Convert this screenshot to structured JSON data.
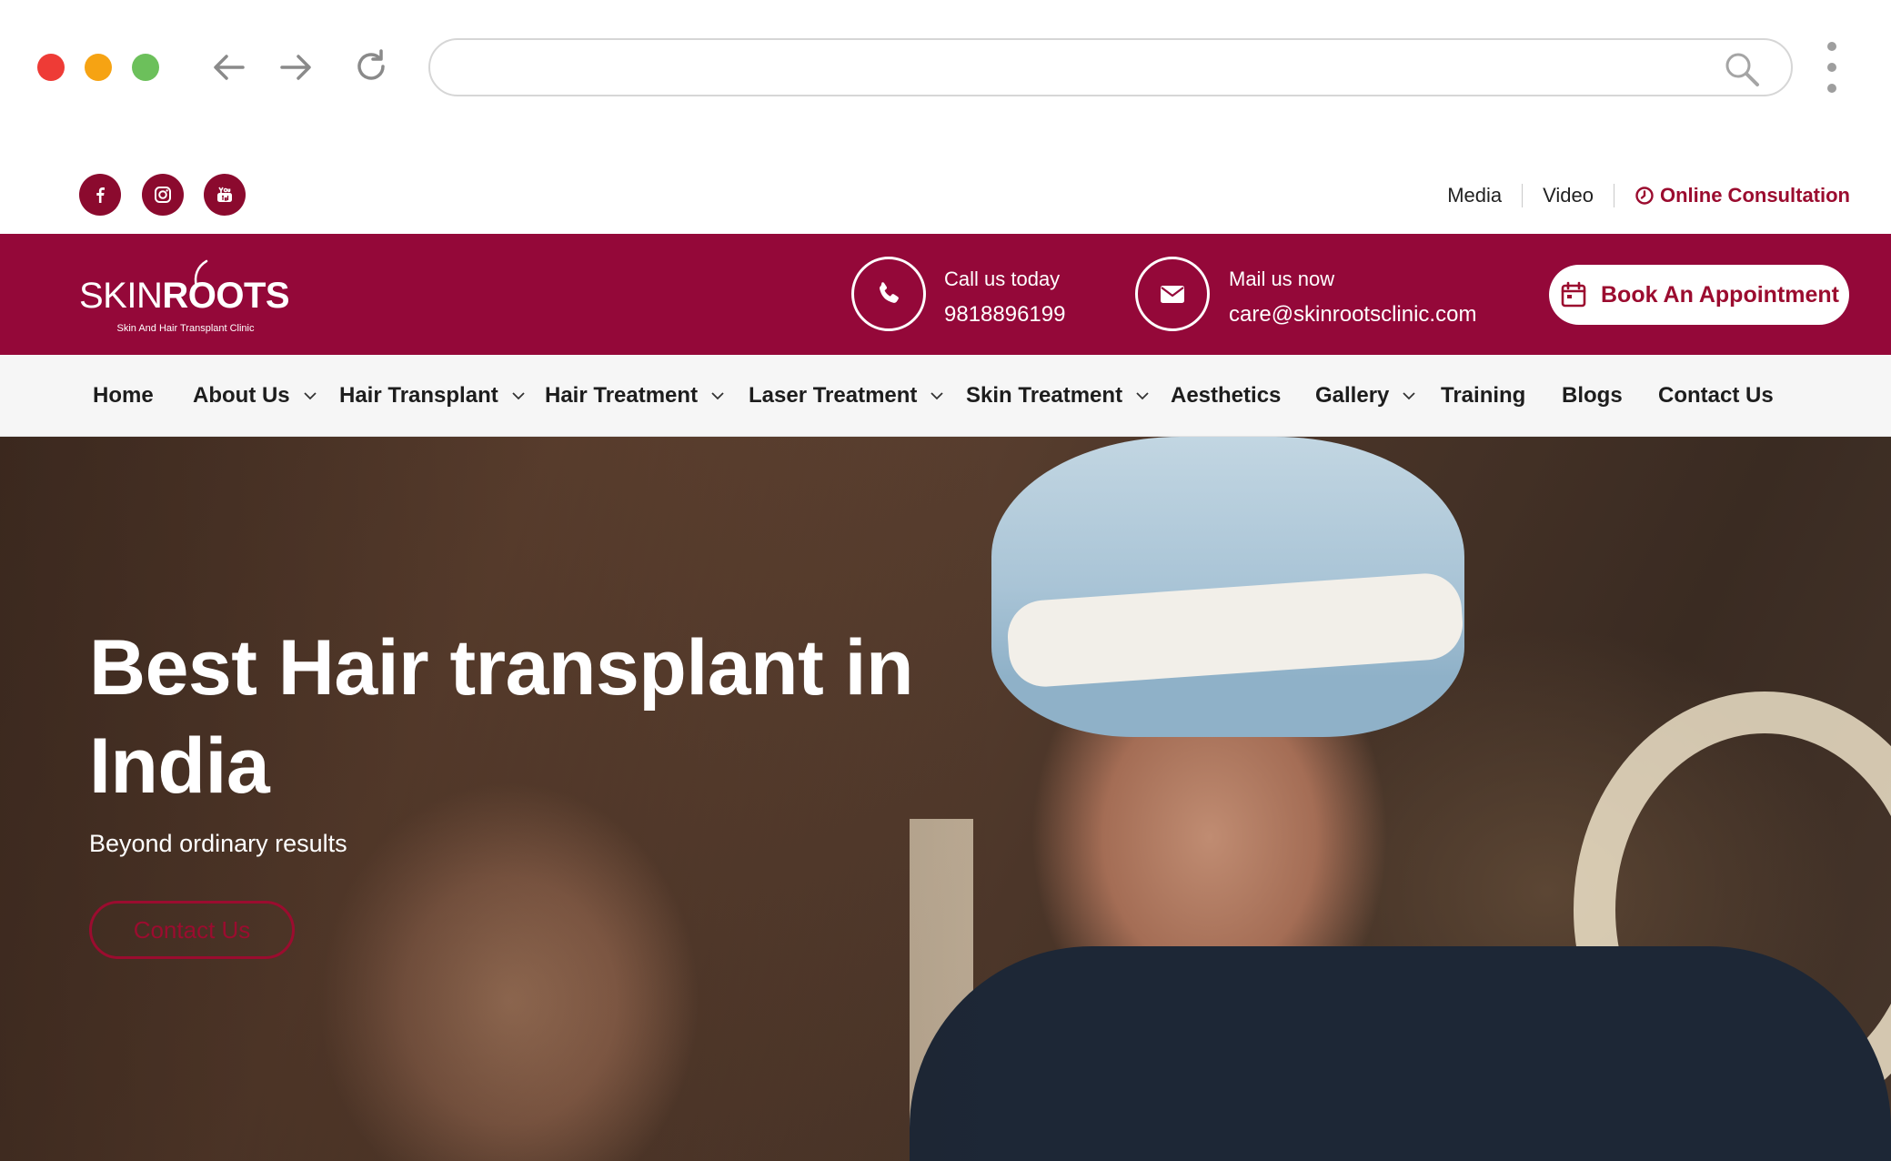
{
  "browser": {
    "url_placeholder": ""
  },
  "topbar": {
    "social": [
      "facebook",
      "instagram",
      "youtube"
    ],
    "links": {
      "media": "Media",
      "video": "Video",
      "online_consultation": "Online Consultation"
    }
  },
  "header": {
    "logo": {
      "text_left": "SKIN",
      "text_right": "ROOTS",
      "tagline": "Skin And Hair Transplant Clinic"
    },
    "call": {
      "label": "Call us today",
      "value": "9818896199"
    },
    "mail": {
      "label": "Mail us now",
      "value": "care@skinrootsclinic.com"
    },
    "book_button": "Book An Appointment"
  },
  "nav": {
    "items": [
      {
        "label": "Home"
      },
      {
        "label": "About Us"
      },
      {
        "label": "Hair Transplant"
      },
      {
        "label": "Hair Treatment"
      },
      {
        "label": "Laser Treatment"
      },
      {
        "label": "Skin Treatment"
      },
      {
        "label": "Aesthetics"
      },
      {
        "label": "Gallery"
      },
      {
        "label": "Training"
      },
      {
        "label": "Blogs"
      },
      {
        "label": "Contact Us"
      }
    ]
  },
  "hero": {
    "title": "Best Hair transplant in India",
    "subtitle": "Beyond ordinary results",
    "button": "Contact Us"
  },
  "colors": {
    "brand_maroon": "#940839",
    "accent_red": "#9b0c2f",
    "nav_bg": "#f6f6f6"
  }
}
